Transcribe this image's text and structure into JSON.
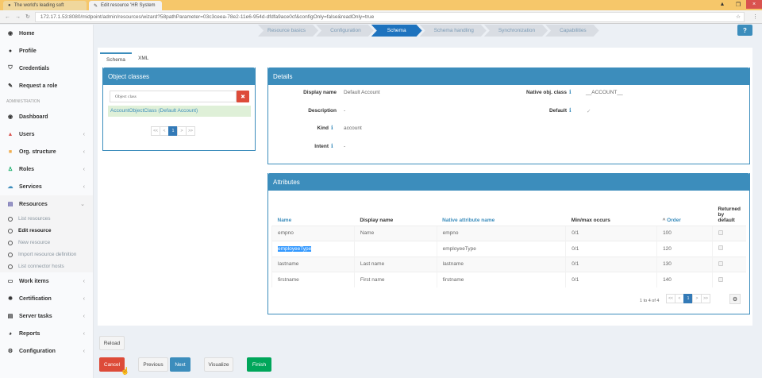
{
  "browser": {
    "tabs": [
      "The world's leading soft",
      "Edit resource 'HR System"
    ],
    "url": "172.17.1.53:8080/midpoint/admin/resources/wizard?58pathParameter=03c3ceea-78e2-11e6-954d-dfdfa9ace0cf&configOnly=false&readOnly=true"
  },
  "sidebar": {
    "items_top": [
      {
        "label": "Home",
        "icon": "dashboard-icon"
      },
      {
        "label": "Profile",
        "icon": "user-icon"
      },
      {
        "label": "Credentials",
        "icon": "shield-icon"
      },
      {
        "label": "Request a role",
        "icon": "edit-icon"
      }
    ],
    "section": "ADMINISTRATION",
    "items_admin": [
      {
        "label": "Dashboard"
      },
      {
        "label": "Users"
      },
      {
        "label": "Org. structure"
      },
      {
        "label": "Roles"
      },
      {
        "label": "Services"
      }
    ],
    "resources": {
      "label": "Resources",
      "sub": [
        "List resources",
        "Edit resource",
        "New resource",
        "Import resource definition",
        "List connector hosts"
      ]
    },
    "items_bottom": [
      {
        "label": "Work items"
      },
      {
        "label": "Certification"
      },
      {
        "label": "Server tasks"
      },
      {
        "label": "Reports"
      },
      {
        "label": "Configuration"
      }
    ]
  },
  "wizard": {
    "steps": [
      "Resource basics",
      "Configuration",
      "Schema",
      "Schema handling",
      "Synchronization",
      "Capabilities"
    ],
    "active": 2
  },
  "tabs": [
    "Schema",
    "XML"
  ],
  "object_classes": {
    "title": "Object classes",
    "placeholder": "Object class",
    "selected": "AccountObjectClass (Default Account)",
    "pager": [
      "<<",
      "<",
      "1",
      ">",
      ">>"
    ]
  },
  "details": {
    "title": "Details",
    "display_name_label": "Display name",
    "display_name": "Default Account",
    "description_label": "Description",
    "description": "-",
    "kind_label": "Kind",
    "kind": "account",
    "intent_label": "Intent",
    "intent": "-",
    "native_label": "Native obj. class",
    "native": "__ACCOUNT__",
    "default_label": "Default",
    "default": "✓"
  },
  "attributes": {
    "title": "Attributes",
    "columns": [
      "Name",
      "Display name",
      "Native attribute name",
      "Min/max occurs",
      "Order",
      "Returned by default"
    ],
    "rows": [
      [
        "empno",
        "Name",
        "empno",
        "0/1",
        "100"
      ],
      [
        "employeeType",
        "",
        "employeeType",
        "0/1",
        "120"
      ],
      [
        "lastname",
        "Last name",
        "lastname",
        "0/1",
        "130"
      ],
      [
        "firstname",
        "First name",
        "firstname",
        "0/1",
        "140"
      ]
    ],
    "count": "1 to 4 of 4",
    "pager": [
      "<<",
      "<",
      "1",
      ">",
      ">>"
    ]
  },
  "buttons": {
    "reload": "Reload",
    "cancel": "Cancel",
    "previous": "Previous",
    "next": "Next",
    "visualize": "Visualize",
    "finish": "Finish"
  }
}
